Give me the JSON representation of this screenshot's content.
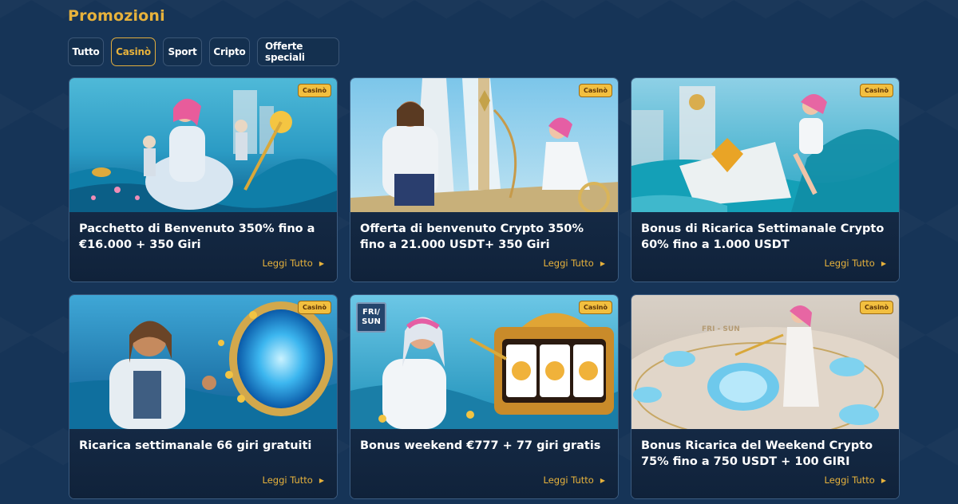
{
  "page": {
    "title": "Promozioni"
  },
  "filters": [
    {
      "label": "Tutto",
      "active": false
    },
    {
      "label": "Casinò",
      "active": true
    },
    {
      "label": "Sport",
      "active": false
    },
    {
      "label": "Cripto",
      "active": false
    },
    {
      "label": "Offerte speciali",
      "active": false
    }
  ],
  "cards": [
    {
      "badge": "Casinò",
      "title": "Pacchetto di Benvenuto 350% fino a €16.000 + 350 Giri",
      "cta": "Leggi Tutto"
    },
    {
      "badge": "Casinò",
      "title": "Offerta di benvenuto Crypto 350% fino a 21.000 USDT+ 350 Giri",
      "cta": "Leggi Tutto"
    },
    {
      "badge": "Casinò",
      "title": "Bonus di Ricarica Settimanale Crypto 60% fino a 1.000 USDT",
      "cta": "Leggi Tutto"
    },
    {
      "badge": "Casinò",
      "title": "Ricarica settimanale 66 giri gratuiti",
      "cta": "Leggi Tutto"
    },
    {
      "badge": "Casinò",
      "title": "Bonus weekend €777 + 77 giri gratis",
      "cta": "Leggi Tutto",
      "day_badge": "FRI/ SUN"
    },
    {
      "badge": "Casinò",
      "title": "Bonus Ricarica del Weekend Crypto 75% fino a 750 USDT + 100 GIRI",
      "cta": "Leggi Tutto",
      "image_text": "FRI - SUN"
    }
  ],
  "icons": {
    "read_more": "arrow-right-icon"
  },
  "colors": {
    "accent": "#e7b23c",
    "background": "#163457",
    "card": "#10223a"
  }
}
